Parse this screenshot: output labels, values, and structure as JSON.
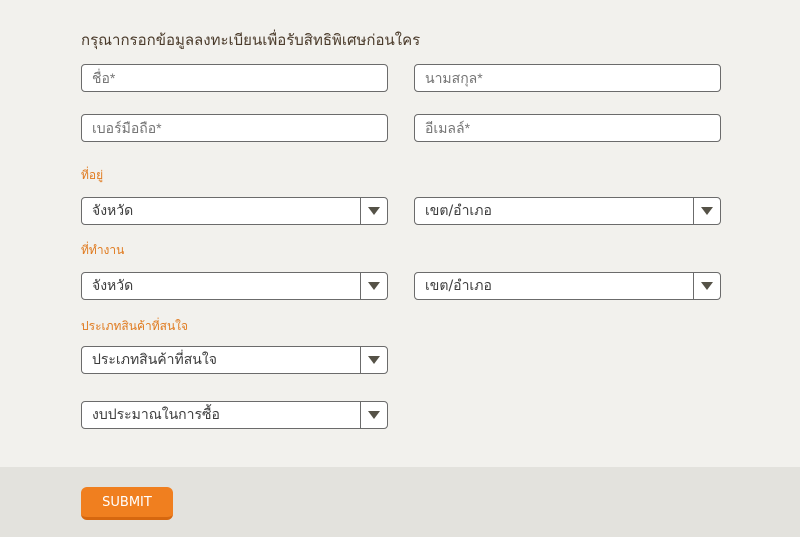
{
  "form": {
    "title": "กรุณากรอกข้อมูลลงทะเบียนเพื่อรับสิทธิพิเศษก่อนใคร",
    "first_name_placeholder": "ชื่อ*",
    "last_name_placeholder": "นามสกุล*",
    "phone_placeholder": "เบอร์มือถือ*",
    "email_placeholder": "อีเมลล์*",
    "address_label": "ที่อยู่",
    "address_province": "จังหวัด",
    "address_district": "เขต/อำเภอ",
    "work_label": "ที่ทำงาน",
    "work_province": "จังหวัด",
    "work_district": "เขต/อำเภอ",
    "interest_label": "ประเภทสินค้าที่สนใจ",
    "interest_select": "ประเภทสินค้าที่สนใจ",
    "budget_select": "งบประมาณในการซื้อ",
    "submit_label": "SUBMIT"
  },
  "icons": {
    "select_arrow": "triangle-down-icon"
  },
  "colors": {
    "accent": "#f07f1f",
    "label": "#e07b20",
    "background": "#f2f1ed",
    "footer": "#e3e2dd"
  }
}
